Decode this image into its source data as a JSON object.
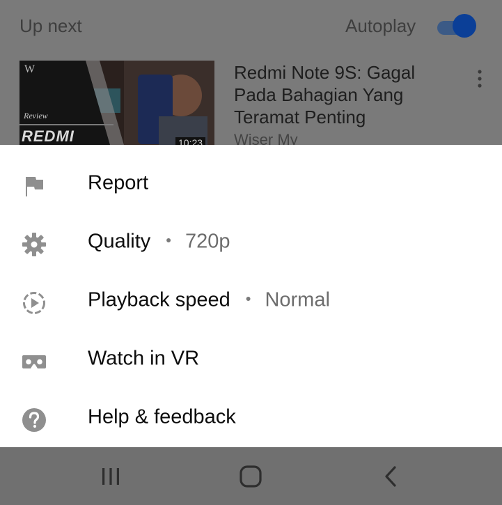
{
  "up_next": {
    "label": "Up next",
    "autoplay_label": "Autoplay",
    "autoplay_on": true,
    "video": {
      "title": "Redmi Note 9S: Gagal Pada Bahagian Yang Teramat Penting",
      "channel": "Wiser My",
      "thumbnail_brand": "W",
      "thumbnail_text_review": "Review",
      "thumbnail_text_main": "REDMI",
      "thumbnail_duration": "10:23",
      "more_icon": "more-vert-icon"
    }
  },
  "menu": {
    "items": [
      {
        "id": "report",
        "label": "Report",
        "icon": "flag-icon",
        "value": ""
      },
      {
        "id": "quality",
        "label": "Quality",
        "icon": "gear-icon",
        "value": "720p"
      },
      {
        "id": "playback-speed",
        "label": "Playback speed",
        "icon": "playback-speed-icon",
        "value": "Normal"
      },
      {
        "id": "watch-in-vr",
        "label": "Watch in VR",
        "icon": "vr-headset-icon",
        "value": ""
      },
      {
        "id": "help-feedback",
        "label": "Help & feedback",
        "icon": "help-circle-icon",
        "value": ""
      }
    ],
    "separator": "•"
  },
  "system_nav": {
    "recents_icon": "recents-icon",
    "home_icon": "home-icon",
    "back_icon": "back-icon"
  },
  "colors": {
    "sheet_background": "#ffffff",
    "icon_gray": "#8f8f8f",
    "toggle_on": "#0b3f97"
  }
}
